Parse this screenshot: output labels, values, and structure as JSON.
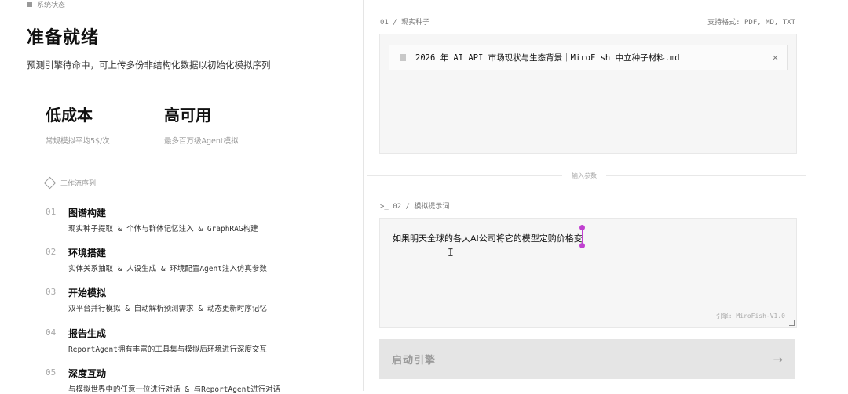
{
  "status": {
    "label": "系统状态"
  },
  "hero": {
    "title": "准备就绪",
    "subtitle": "预测引擎待命中，可上传多份非结构化数据以初始化模拟序列"
  },
  "metrics": [
    {
      "big": "低成本",
      "small": "常规模拟平均5$/次"
    },
    {
      "big": "高可用",
      "small": "最多百万级Agent模拟"
    }
  ],
  "workflow": {
    "header": "工作流序列",
    "steps": [
      {
        "num": "01",
        "name": "图谱构建",
        "desc": "现实种子提取 & 个体与群体记忆注入 & GraphRAG构建"
      },
      {
        "num": "02",
        "name": "环境搭建",
        "desc": "实体关系抽取 & 人设生成 & 环境配置Agent注入仿真参数"
      },
      {
        "num": "03",
        "name": "开始模拟",
        "desc": "双平台并行模拟 & 自动解析预测需求 & 动态更新时序记忆"
      },
      {
        "num": "04",
        "name": "报告生成",
        "desc": "ReportAgent拥有丰富的工具集与模拟后环境进行深度交互"
      },
      {
        "num": "05",
        "name": "深度互动",
        "desc": "与模拟世界中的任意一位进行对话 & 与ReportAgent进行对话"
      }
    ]
  },
  "seed": {
    "label": "01 / 现实种子",
    "formats": "支持格式: PDF, MD, TXT",
    "file": {
      "name": "2026 年 AI API 市场现状与生态背景｜MiroFish 中立种子材料.md",
      "close": "×"
    }
  },
  "params_divider": "输入参数",
  "prompt": {
    "label": ">_ 02 / 模拟提示词",
    "value": "如果明天全球的各大AI公司将它的模型定购价格变",
    "engine": "引擎: MiroFish-V1.0"
  },
  "launch": {
    "label": "启动引擎",
    "arrow": "→"
  },
  "colors": {
    "accent": "#c040d0",
    "panel_bg": "#f6f6f6",
    "button_bg": "#e5e5e5"
  }
}
